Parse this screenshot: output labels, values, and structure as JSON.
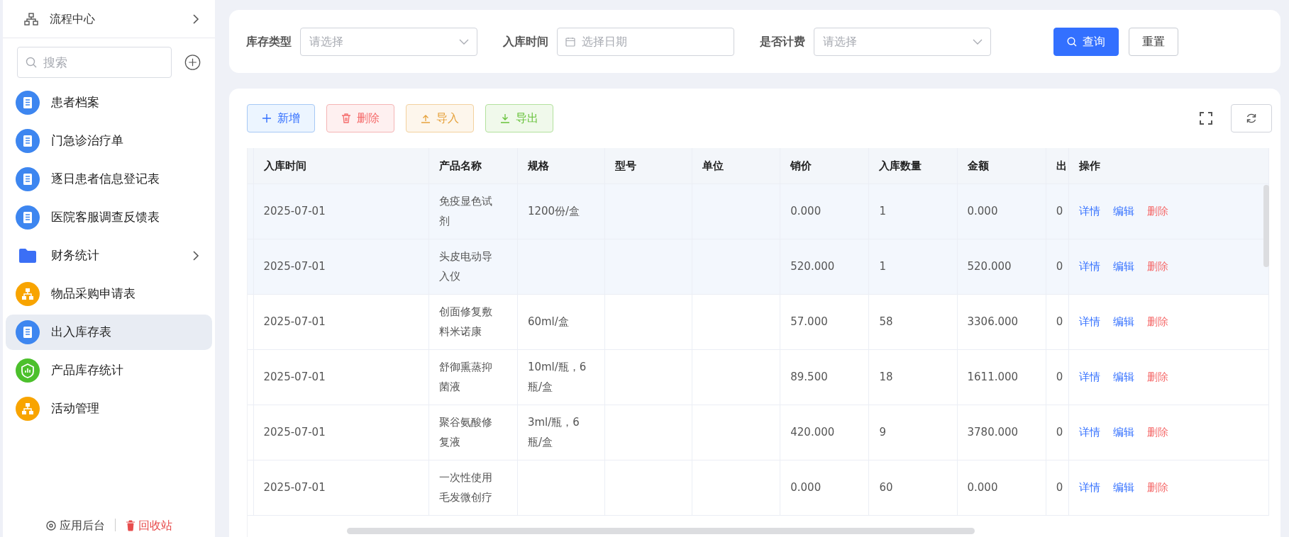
{
  "sidebar": {
    "header": {
      "label": "流程中心",
      "expandable": true
    },
    "search": {
      "placeholder": "搜索"
    },
    "items": [
      {
        "label": "患者档案",
        "kind": "doc",
        "selected": false,
        "expandable": false
      },
      {
        "label": "门急诊治疗单",
        "kind": "doc",
        "selected": false,
        "expandable": false
      },
      {
        "label": "逐日患者信息登记表",
        "kind": "doc",
        "selected": false,
        "expandable": false
      },
      {
        "label": "医院客服调查反馈表",
        "kind": "doc",
        "selected": false,
        "expandable": false
      },
      {
        "label": "财务统计",
        "kind": "folder",
        "selected": false,
        "expandable": true
      },
      {
        "label": "物品采购申请表",
        "kind": "org",
        "selected": false,
        "expandable": false
      },
      {
        "label": "出入库存表",
        "kind": "doc",
        "selected": true,
        "expandable": false
      },
      {
        "label": "产品库存统计",
        "kind": "chart",
        "selected": false,
        "expandable": false
      },
      {
        "label": "活动管理",
        "kind": "org",
        "selected": false,
        "expandable": false
      }
    ],
    "footer": [
      {
        "label": "应用后台",
        "kind": "settings"
      },
      {
        "label": "回收站",
        "kind": "trash"
      }
    ]
  },
  "filters": [
    {
      "label": "库存类型",
      "kind": "select",
      "placeholder": "请选择"
    },
    {
      "label": "入库时间",
      "kind": "date",
      "placeholder": "选择日期"
    },
    {
      "label": "是否计费",
      "kind": "select",
      "placeholder": "请选择"
    }
  ],
  "filter_buttons": [
    {
      "label": "查询",
      "kind": "primary"
    },
    {
      "label": "重置",
      "kind": "default"
    }
  ],
  "toolbar": [
    {
      "label": "新增",
      "kind": "add"
    },
    {
      "label": "删除",
      "kind": "delete"
    },
    {
      "label": "导入",
      "kind": "import"
    },
    {
      "label": "导出",
      "kind": "export"
    }
  ],
  "table": {
    "columns": [
      "入库时间",
      "产品名称",
      "规格",
      "型号",
      "单位",
      "销价",
      "入库数量",
      "金额",
      "出",
      "操作"
    ],
    "rows": [
      {
        "selected": true,
        "cells": [
          "2025-07-01",
          "免疫显色试剂",
          "1200份/盒",
          null,
          null,
          "0.000",
          "1",
          "0.000",
          "0"
        ],
        "actions": [
          {
            "label": "详情",
            "kind": "link"
          },
          {
            "label": "编辑",
            "kind": "link"
          },
          {
            "label": "删除",
            "kind": "danger"
          }
        ]
      },
      {
        "selected": true,
        "cells": [
          "2025-07-01",
          "头皮电动导入仪",
          null,
          null,
          null,
          "520.000",
          "1",
          "520.000",
          "0"
        ],
        "actions": [
          {
            "label": "详情",
            "kind": "link"
          },
          {
            "label": "编辑",
            "kind": "link"
          },
          {
            "label": "删除",
            "kind": "danger"
          }
        ]
      },
      {
        "selected": false,
        "cells": [
          "2025-07-01",
          "创面修复敷料米诺康",
          "60ml/盒",
          null,
          null,
          "57.000",
          "58",
          "3306.000",
          "0"
        ],
        "actions": [
          {
            "label": "详情",
            "kind": "link"
          },
          {
            "label": "编辑",
            "kind": "link"
          },
          {
            "label": "删除",
            "kind": "danger"
          }
        ]
      },
      {
        "selected": false,
        "cells": [
          "2025-07-01",
          "舒御熏蒸抑菌液",
          "10ml/瓶，6瓶/盒",
          null,
          null,
          "89.500",
          "18",
          "1611.000",
          "0"
        ],
        "actions": [
          {
            "label": "详情",
            "kind": "link"
          },
          {
            "label": "编辑",
            "kind": "link"
          },
          {
            "label": "删除",
            "kind": "danger"
          }
        ]
      },
      {
        "selected": false,
        "cells": [
          "2025-07-01",
          "聚谷氨酸修复液",
          "3ml/瓶，6瓶/盒",
          null,
          null,
          "420.000",
          "9",
          "3780.000",
          "0"
        ],
        "actions": [
          {
            "label": "详情",
            "kind": "link"
          },
          {
            "label": "编辑",
            "kind": "link"
          },
          {
            "label": "删除",
            "kind": "danger"
          }
        ]
      },
      {
        "selected": false,
        "cells": [
          "2025-07-01",
          "一次性使用毛发微创疗",
          null,
          null,
          null,
          "0.000",
          "60",
          "0.000",
          "0"
        ],
        "actions": [
          {
            "label": "详情",
            "kind": "link"
          },
          {
            "label": "编辑",
            "kind": "link"
          },
          {
            "label": "删除",
            "kind": "danger"
          }
        ]
      }
    ]
  }
}
